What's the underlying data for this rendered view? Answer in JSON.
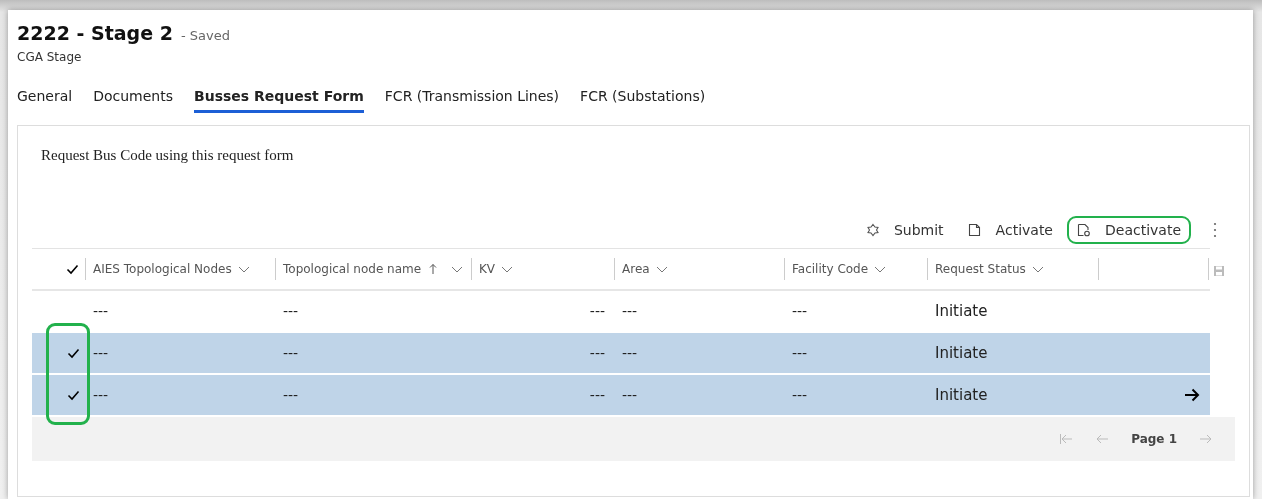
{
  "record": {
    "title": "2222 - Stage 2",
    "save_state": "- Saved",
    "entity": "CGA Stage"
  },
  "tabs": [
    {
      "label": "General",
      "selected": false
    },
    {
      "label": "Documents",
      "selected": false
    },
    {
      "label": "Busses Request Form",
      "selected": true
    },
    {
      "label": "FCR (Transmission Lines)",
      "selected": false
    },
    {
      "label": "FCR (Substations)",
      "selected": false
    }
  ],
  "section": {
    "description": "Request Bus Code using this request form"
  },
  "commands": [
    {
      "kind": "submit",
      "label": "Submit",
      "highlighted": false
    },
    {
      "kind": "activate",
      "label": "Activate",
      "highlighted": false
    },
    {
      "kind": "deactivate",
      "label": "Deactivate",
      "highlighted": true
    }
  ],
  "grid": {
    "selection_highlighted": true,
    "columns": [
      {
        "label": "AIES Topological Nodes",
        "kind": "text",
        "sorted_ascending": false
      },
      {
        "label": "Topological node name",
        "kind": "text",
        "sorted_ascending": true
      },
      {
        "label": "KV",
        "kind": "number",
        "sorted_ascending": false
      },
      {
        "label": "Area",
        "kind": "text",
        "sorted_ascending": false
      },
      {
        "label": "Facility Code",
        "kind": "text",
        "sorted_ascending": false
      },
      {
        "label": "Request Status",
        "kind": "text",
        "sorted_ascending": false
      }
    ],
    "rows": [
      {
        "selected": false,
        "focused": false,
        "cells": [
          "---",
          "---",
          "---",
          "---",
          "---",
          "Initiate"
        ]
      },
      {
        "selected": true,
        "focused": false,
        "cells": [
          "---",
          "---",
          "---",
          "---",
          "---",
          "Initiate"
        ]
      },
      {
        "selected": true,
        "focused": true,
        "cells": [
          "---",
          "---",
          "---",
          "---",
          "---",
          "Initiate"
        ]
      }
    ],
    "pager": {
      "label": "Page 1"
    }
  }
}
